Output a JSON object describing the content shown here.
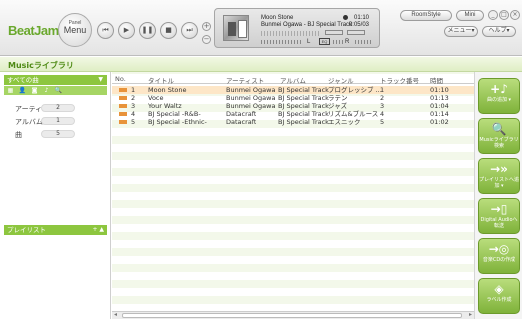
{
  "app": {
    "logo": "BeatJam"
  },
  "toolbar": {
    "panel_small": "Panel",
    "panel_big": "Menu",
    "room_style": "RoomStyle",
    "mini": "Mini",
    "menu": "メニュー▾",
    "help": "ヘルプ▾"
  },
  "now_playing": {
    "title": "Moon Stone",
    "subtitle": "Bunmei Ogawa - BJ Special Track",
    "time_elapsed": "01:10",
    "time_total": "0:05/03",
    "left_channel": "L",
    "right_channel": "R"
  },
  "library": {
    "title": "Musicライブラリ"
  },
  "sidebar": {
    "all_songs": "すべての曲",
    "categories": [
      {
        "label": "アーティスト",
        "count": "2"
      },
      {
        "label": "アルバム",
        "count": "1"
      },
      {
        "label": "曲",
        "count": "5"
      }
    ],
    "playlist": "プレイリスト"
  },
  "table": {
    "columns": [
      "No.",
      "タイトル",
      "アーティスト",
      "アルバム",
      "ジャンル",
      "トラック番号",
      "時間"
    ],
    "rows": [
      {
        "no": "1",
        "title": "Moon Stone",
        "artist": "Bunmei Ogawa",
        "album": "BJ Special Track",
        "genre": "プログレッシブ ...",
        "track": "1",
        "time": "01:10"
      },
      {
        "no": "2",
        "title": "Voce",
        "artist": "Bunmei Ogawa",
        "album": "BJ Special Track",
        "genre": "ラテン",
        "track": "2",
        "time": "01:13"
      },
      {
        "no": "3",
        "title": "Your Waltz",
        "artist": "Bunmei Ogawa",
        "album": "BJ Special Track",
        "genre": "ジャズ",
        "track": "3",
        "time": "01:04"
      },
      {
        "no": "4",
        "title": "BJ Special -R&B-",
        "artist": "Datacraft",
        "album": "BJ Special Track",
        "genre": "リズム&ブルース",
        "track": "4",
        "time": "01:14"
      },
      {
        "no": "5",
        "title": "BJ Special -Ethnic-",
        "artist": "Datacraft",
        "album": "BJ Special Track",
        "genre": "エスニック",
        "track": "5",
        "time": "01:02"
      }
    ]
  },
  "actions": [
    {
      "icon": "+♪",
      "label": "曲の追加 ▾"
    },
    {
      "icon": "🔍",
      "label": "Musicライブラリ検索"
    },
    {
      "icon": "→»",
      "label": "プレイリストへ追加 ▾"
    },
    {
      "icon": "→▯",
      "label": "Digital Audioへ転送"
    },
    {
      "icon": "→◎",
      "label": "音楽CDの作成"
    },
    {
      "icon": "◈",
      "label": "ラベル作成"
    }
  ]
}
